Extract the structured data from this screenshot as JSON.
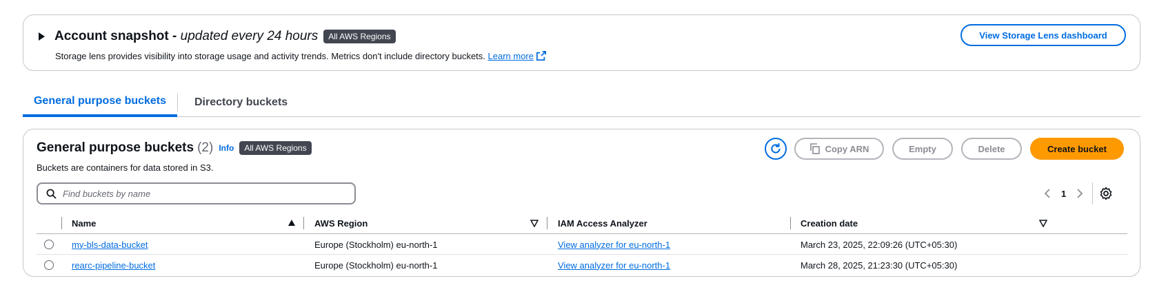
{
  "snapshot": {
    "title": "Account snapshot - ",
    "subtitle": "updated every 24 hours",
    "badge": "All AWS Regions",
    "description": "Storage lens provides visibility into storage usage and activity trends. Metrics don't include directory buckets. ",
    "learn_more": "Learn more",
    "lens_button": "View Storage Lens dashboard"
  },
  "tabs": [
    {
      "label": "General purpose buckets",
      "active": true
    },
    {
      "label": "Directory buckets",
      "active": false
    }
  ],
  "buckets": {
    "title": "General purpose buckets",
    "count": "(2)",
    "info": "Info",
    "badge": "All AWS Regions",
    "description": "Buckets are containers for data stored in S3.",
    "actions": {
      "copy_arn": "Copy ARN",
      "empty": "Empty",
      "delete": "Delete",
      "create": "Create bucket"
    },
    "search_placeholder": "Find buckets by name",
    "page": "1",
    "columns": [
      "Name",
      "AWS Region",
      "IAM Access Analyzer",
      "Creation date"
    ],
    "rows": [
      {
        "name": "my-bls-data-bucket",
        "region": "Europe (Stockholm) eu-north-1",
        "analyzer": "View analyzer for eu-north-1",
        "created": "March 23, 2025, 22:09:26 (UTC+05:30)"
      },
      {
        "name": "rearc-pipeline-bucket",
        "region": "Europe (Stockholm) eu-north-1",
        "analyzer": "View analyzer for eu-north-1",
        "created": "March 28, 2025, 21:23:30 (UTC+05:30)"
      }
    ]
  },
  "colors": {
    "accent": "#006ce0",
    "primary_button": "#ff9900",
    "badge_bg": "#424650"
  },
  "icons": [
    "caret-right-icon",
    "external-link-icon",
    "refresh-icon",
    "copy-icon",
    "search-icon",
    "chevron-left-icon",
    "chevron-right-icon",
    "settings-gear-icon",
    "sort-ascending-icon",
    "sort-descending-icon"
  ]
}
